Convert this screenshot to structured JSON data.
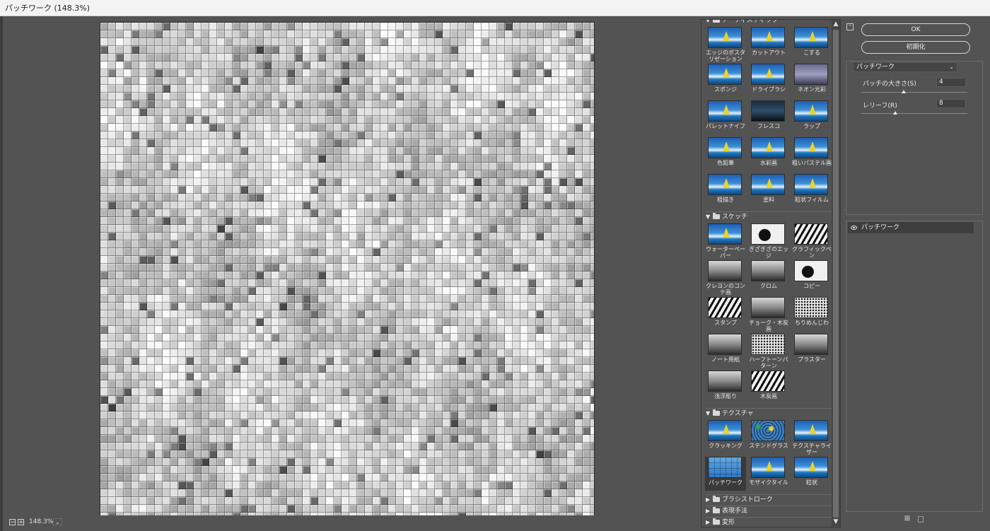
{
  "window": {
    "title": "パッチワーク (148.3%)"
  },
  "status": {
    "zoom": "148.3%",
    "zoom_out": "−",
    "zoom_in": "+",
    "zoom_menu": "⌄"
  },
  "gallery": {
    "categories": [
      {
        "name": "アーティスティック",
        "expanded": true,
        "filters": [
          {
            "label": "エッジのポスタリゼーション",
            "style": "color"
          },
          {
            "label": "カットアウト",
            "style": "color"
          },
          {
            "label": "こする",
            "style": "color"
          },
          {
            "label": "スポンジ",
            "style": "color"
          },
          {
            "label": "ドライブラシ",
            "style": "color"
          },
          {
            "label": "ネオン光彩",
            "style": "neon"
          },
          {
            "label": "パレットナイフ",
            "style": "color"
          },
          {
            "label": "フレスコ",
            "style": "dark"
          },
          {
            "label": "ラップ",
            "style": "color"
          },
          {
            "label": "色鉛筆",
            "style": "color"
          },
          {
            "label": "水彩画",
            "style": "color"
          },
          {
            "label": "粗いパステル画",
            "style": "color"
          },
          {
            "label": "粗描き",
            "style": "color"
          },
          {
            "label": "塗料",
            "style": "color"
          },
          {
            "label": "粒状フィルム",
            "style": "color"
          }
        ]
      },
      {
        "name": "スケッチ",
        "expanded": true,
        "filters": [
          {
            "label": "ウォーターペーパー",
            "style": "color"
          },
          {
            "label": "ぎざぎざのエッジ",
            "style": "bw2"
          },
          {
            "label": "グラフィックペン",
            "style": "bw"
          },
          {
            "label": "クレヨンのコンテ画",
            "style": "gray"
          },
          {
            "label": "クロム",
            "style": "gray"
          },
          {
            "label": "コピー",
            "style": "bw2"
          },
          {
            "label": "スタンプ",
            "style": "bw"
          },
          {
            "label": "チョーク・木炭画",
            "style": "gray"
          },
          {
            "label": "ちりめんじわ",
            "style": "dots"
          },
          {
            "label": "ノート用紙",
            "style": "gray"
          },
          {
            "label": "ハーフトーンパターン",
            "style": "dots"
          },
          {
            "label": "プラスター",
            "style": "gray"
          },
          {
            "label": "浅浮彫り",
            "style": "gray"
          },
          {
            "label": "木炭画",
            "style": "bw"
          }
        ]
      },
      {
        "name": "テクスチャ",
        "expanded": true,
        "filters": [
          {
            "label": "クラッキング",
            "style": "color"
          },
          {
            "label": "ステンドグラス",
            "style": "stained"
          },
          {
            "label": "テクスチャライザー",
            "style": "color"
          },
          {
            "label": "パッチワーク",
            "style": "patch",
            "selected": true
          },
          {
            "label": "モザイクタイル",
            "style": "color"
          },
          {
            "label": "粒状",
            "style": "color"
          }
        ]
      },
      {
        "name": "ブラシストローク",
        "expanded": false,
        "filters": []
      },
      {
        "name": "表現手法",
        "expanded": false,
        "filters": []
      },
      {
        "name": "変形",
        "expanded": false,
        "filters": []
      }
    ],
    "icons": {
      "expanded": "▼",
      "collapsed": "▶",
      "scroll_up": "▲",
      "scroll_down": "▼"
    }
  },
  "panel": {
    "collapse_icon": "⌃",
    "ok_label": "OK",
    "reset_label": "初期化",
    "filter_select": {
      "value": "パッチワーク",
      "chevron": "⌄"
    },
    "params": [
      {
        "label": "パッチの大きさ(S)",
        "value": "4",
        "fraction": 0.4
      },
      {
        "label": "レリーフ(R)",
        "value": "8",
        "fraction": 0.32
      }
    ],
    "layer": {
      "name": "パッチワーク"
    },
    "new_layer_icon": "⊞",
    "delete_icon": ""
  }
}
